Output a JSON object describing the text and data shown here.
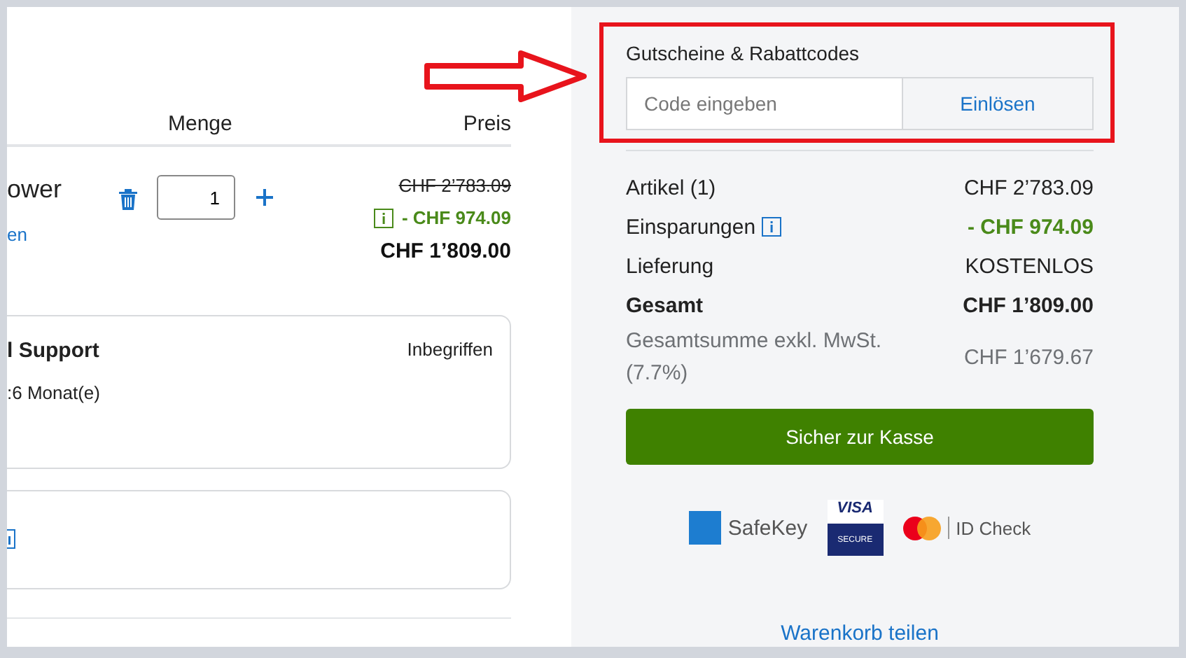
{
  "cart": {
    "columns": [
      "Menge",
      "Preis"
    ],
    "item": {
      "name": "ower",
      "link": "en",
      "quantity": "1",
      "old_price": "CHF 2’783.09",
      "discount": "- CHF 974.09",
      "price": "CHF 1’809.00"
    },
    "service": {
      "title": "l Support",
      "value": "Inbegriffen",
      "detail": ":6 Monat(e)"
    }
  },
  "voucher": {
    "title": "Gutscheine & Rabattcodes",
    "placeholder": "Code eingeben",
    "button": "Einlösen"
  },
  "summary": [
    {
      "label": "Artikel (1)",
      "value": "CHF 2’783.09",
      "kind": "plain"
    },
    {
      "label": "Einsparungen",
      "value": "- CHF 974.09",
      "kind": "saving"
    },
    {
      "label": "Lieferung",
      "value": "KOSTENLOS",
      "kind": "plain"
    },
    {
      "label": "Gesamt",
      "value": "CHF 1’809.00",
      "kind": "total"
    },
    {
      "label": "Gesamtsumme exkl. MwSt. (7.7%)",
      "value": "CHF 1’679.67",
      "kind": "muted"
    }
  ],
  "checkout_button": "Sicher zur Kasse",
  "badges": {
    "amex": "SafeKey",
    "visa_top": "VISA",
    "visa_bottom": "SECURE",
    "mastercard": "ID Check"
  },
  "share_link": "Warenkorb teilen"
}
